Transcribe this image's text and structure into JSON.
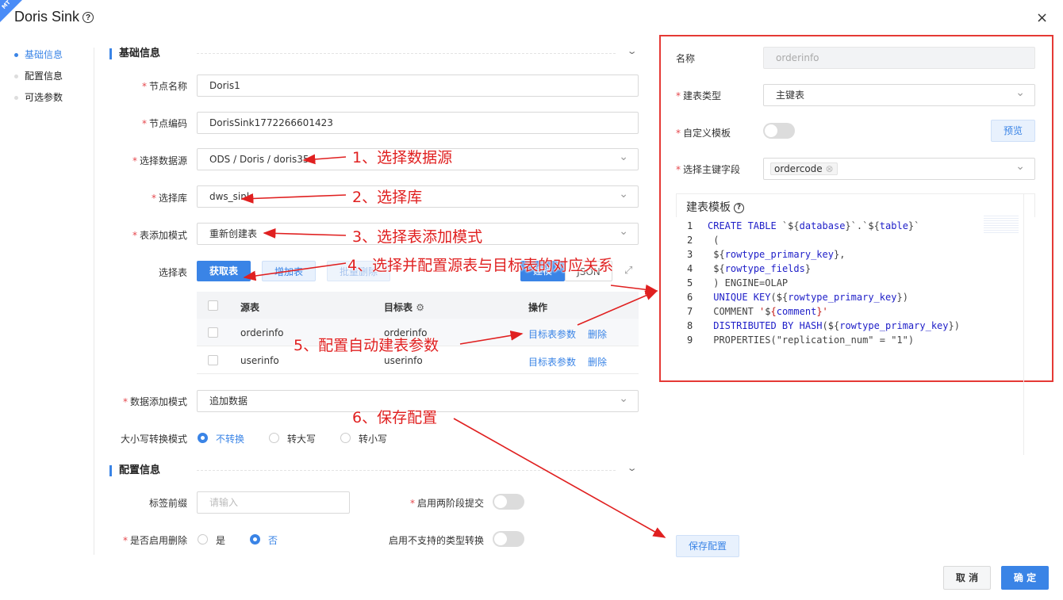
{
  "header": {
    "badge": "MT",
    "title": "Doris Sink",
    "help_icon": "?",
    "close_icon": "×"
  },
  "anchors": [
    "基础信息",
    "配置信息",
    "可选参数"
  ],
  "sections": {
    "basic": "基础信息",
    "config": "配置信息"
  },
  "form": {
    "node_name_label": "节点名称",
    "node_name": "Doris1",
    "node_code_label": "节点编码",
    "node_code": "DorisSink1772266601423",
    "datasource_label": "选择数据源",
    "datasource": "ODS / Doris / doris35",
    "db_label": "选择库",
    "db": "dws_sink",
    "table_mode_label": "表添加模式",
    "table_mode": "重新创建表",
    "select_table_label": "选择表",
    "btn_fetch": "获取表",
    "btn_add": "增加表",
    "btn_batch_delete": "批量删除",
    "btn_toggle_a": "建模",
    "btn_toggle_b": "JSON",
    "expand_icon": "⤢",
    "data_mode_label": "数据添加模式",
    "data_mode": "追加数据",
    "case_label": "大小写转换模式",
    "case_options": [
      "不转换",
      "转大写",
      "转小写"
    ]
  },
  "table": {
    "headers": {
      "source": "源表",
      "target": "目标表",
      "op": "操作"
    },
    "rows": [
      {
        "source": "orderinfo",
        "target": "orderinfo",
        "params": "目标表参数",
        "del": "删除"
      },
      {
        "source": "userinfo",
        "target": "userinfo",
        "params": "目标表参数",
        "del": "删除"
      }
    ]
  },
  "config": {
    "tag_prefix_label": "标签前缀",
    "tag_prefix_placeholder": "请输入",
    "two_phase_label": "启用两阶段提交",
    "enable_delete_label": "是否启用删除",
    "enable_delete_yes": "是",
    "enable_delete_no": "否",
    "unsupported_label": "启用不支持的类型转换"
  },
  "right": {
    "name_label": "名称",
    "name_value": "orderinfo",
    "create_type_label": "建表类型",
    "create_type": "主键表",
    "custom_tpl_label": "自定义模板",
    "preview": "预览",
    "pk_label": "选择主键字段",
    "pk_tag": "ordercode",
    "tpl_title": "建表模板"
  },
  "code_lines": [
    "CREATE TABLE `${database}`.`${table}`",
    " (",
    " ${rowtype_primary_key},",
    " ${rowtype_fields}",
    " ) ENGINE=OLAP",
    " UNIQUE KEY(${rowtype_primary_key})",
    " COMMENT '${comment}'",
    " DISTRIBUTED BY HASH(${rowtype_primary_key})",
    " PROPERTIES(\"replication_num\" = \"1\")"
  ],
  "annotations": {
    "a1": "1、选择数据源",
    "a2": "2、选择库",
    "a3": "3、选择表添加模式",
    "a4": "4、选择并配置源表与目标表的对应关系",
    "a5": "5、配置自动建表参数",
    "a6": "6、保存配置"
  },
  "footer": {
    "save": "保存配置",
    "cancel": "取 消",
    "ok": "确 定"
  },
  "colors": {
    "accent": "#3a84e6",
    "annotation": "#e02020",
    "required": "#e5484d"
  }
}
